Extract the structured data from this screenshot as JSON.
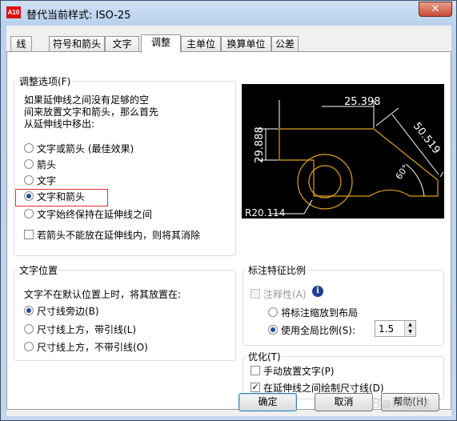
{
  "window": {
    "title": "替代当前样式: ISO-25",
    "app_icon_text": "A10",
    "close_glyph": "✕"
  },
  "tabs": [
    {
      "label": "线"
    },
    {
      "label": "符号和箭头"
    },
    {
      "label": "文字"
    },
    {
      "label": "调整",
      "active": true
    },
    {
      "label": "主单位"
    },
    {
      "label": "换算单位"
    },
    {
      "label": "公差"
    }
  ],
  "fit_options": {
    "legend": "调整选项(F)",
    "description": [
      "如果延伸线之间没有足够的空",
      "间来放置文字和箭头，那么首先",
      "从延伸线中移出:"
    ],
    "options": [
      {
        "label": "文字或箭头 (最佳效果)",
        "selected": false
      },
      {
        "label": "箭头",
        "selected": false
      },
      {
        "label": "文字",
        "selected": false
      },
      {
        "label": "文字和箭头",
        "selected": true
      },
      {
        "label": "文字始终保持在延伸线之间",
        "selected": false
      }
    ],
    "suppress_label": "若箭头不能放在延伸线内，则将其消除",
    "suppress_checked": false
  },
  "preview": {
    "dim_top": "25.398",
    "dim_left": "29.888",
    "dim_right": "50.519",
    "dim_angle": "60°",
    "dim_radius": "R20.114"
  },
  "text_placement": {
    "legend": "文字位置",
    "description": "文字不在默认位置上时，将其放置在:",
    "options": [
      {
        "label": "尺寸线旁边(B)",
        "selected": true
      },
      {
        "label": "尺寸线上方，带引线(L)",
        "selected": false
      },
      {
        "label": "尺寸线上方，不带引线(O)",
        "selected": false
      }
    ]
  },
  "scale": {
    "legend": "标注特征比例",
    "annotative_label": "注释性(A)",
    "annotative_checked": false,
    "info_glyph": "i",
    "options": [
      {
        "label": "将标注缩放到布局",
        "selected": false
      },
      {
        "label": "使用全局比例(S):",
        "selected": true
      }
    ],
    "overall_scale": "1.5"
  },
  "fine_tuning": {
    "legend": "优化(T)",
    "manual_label": "手动放置文字(P)",
    "manual_checked": false,
    "draw_label": "在延伸线之间绘制尺寸线(D)",
    "draw_checked": true,
    "check_glyph": "✓"
  },
  "buttons": {
    "ok": "确定",
    "cancel": "取消",
    "help": "帮助(H)"
  },
  "watermark": "Bai 经验"
}
